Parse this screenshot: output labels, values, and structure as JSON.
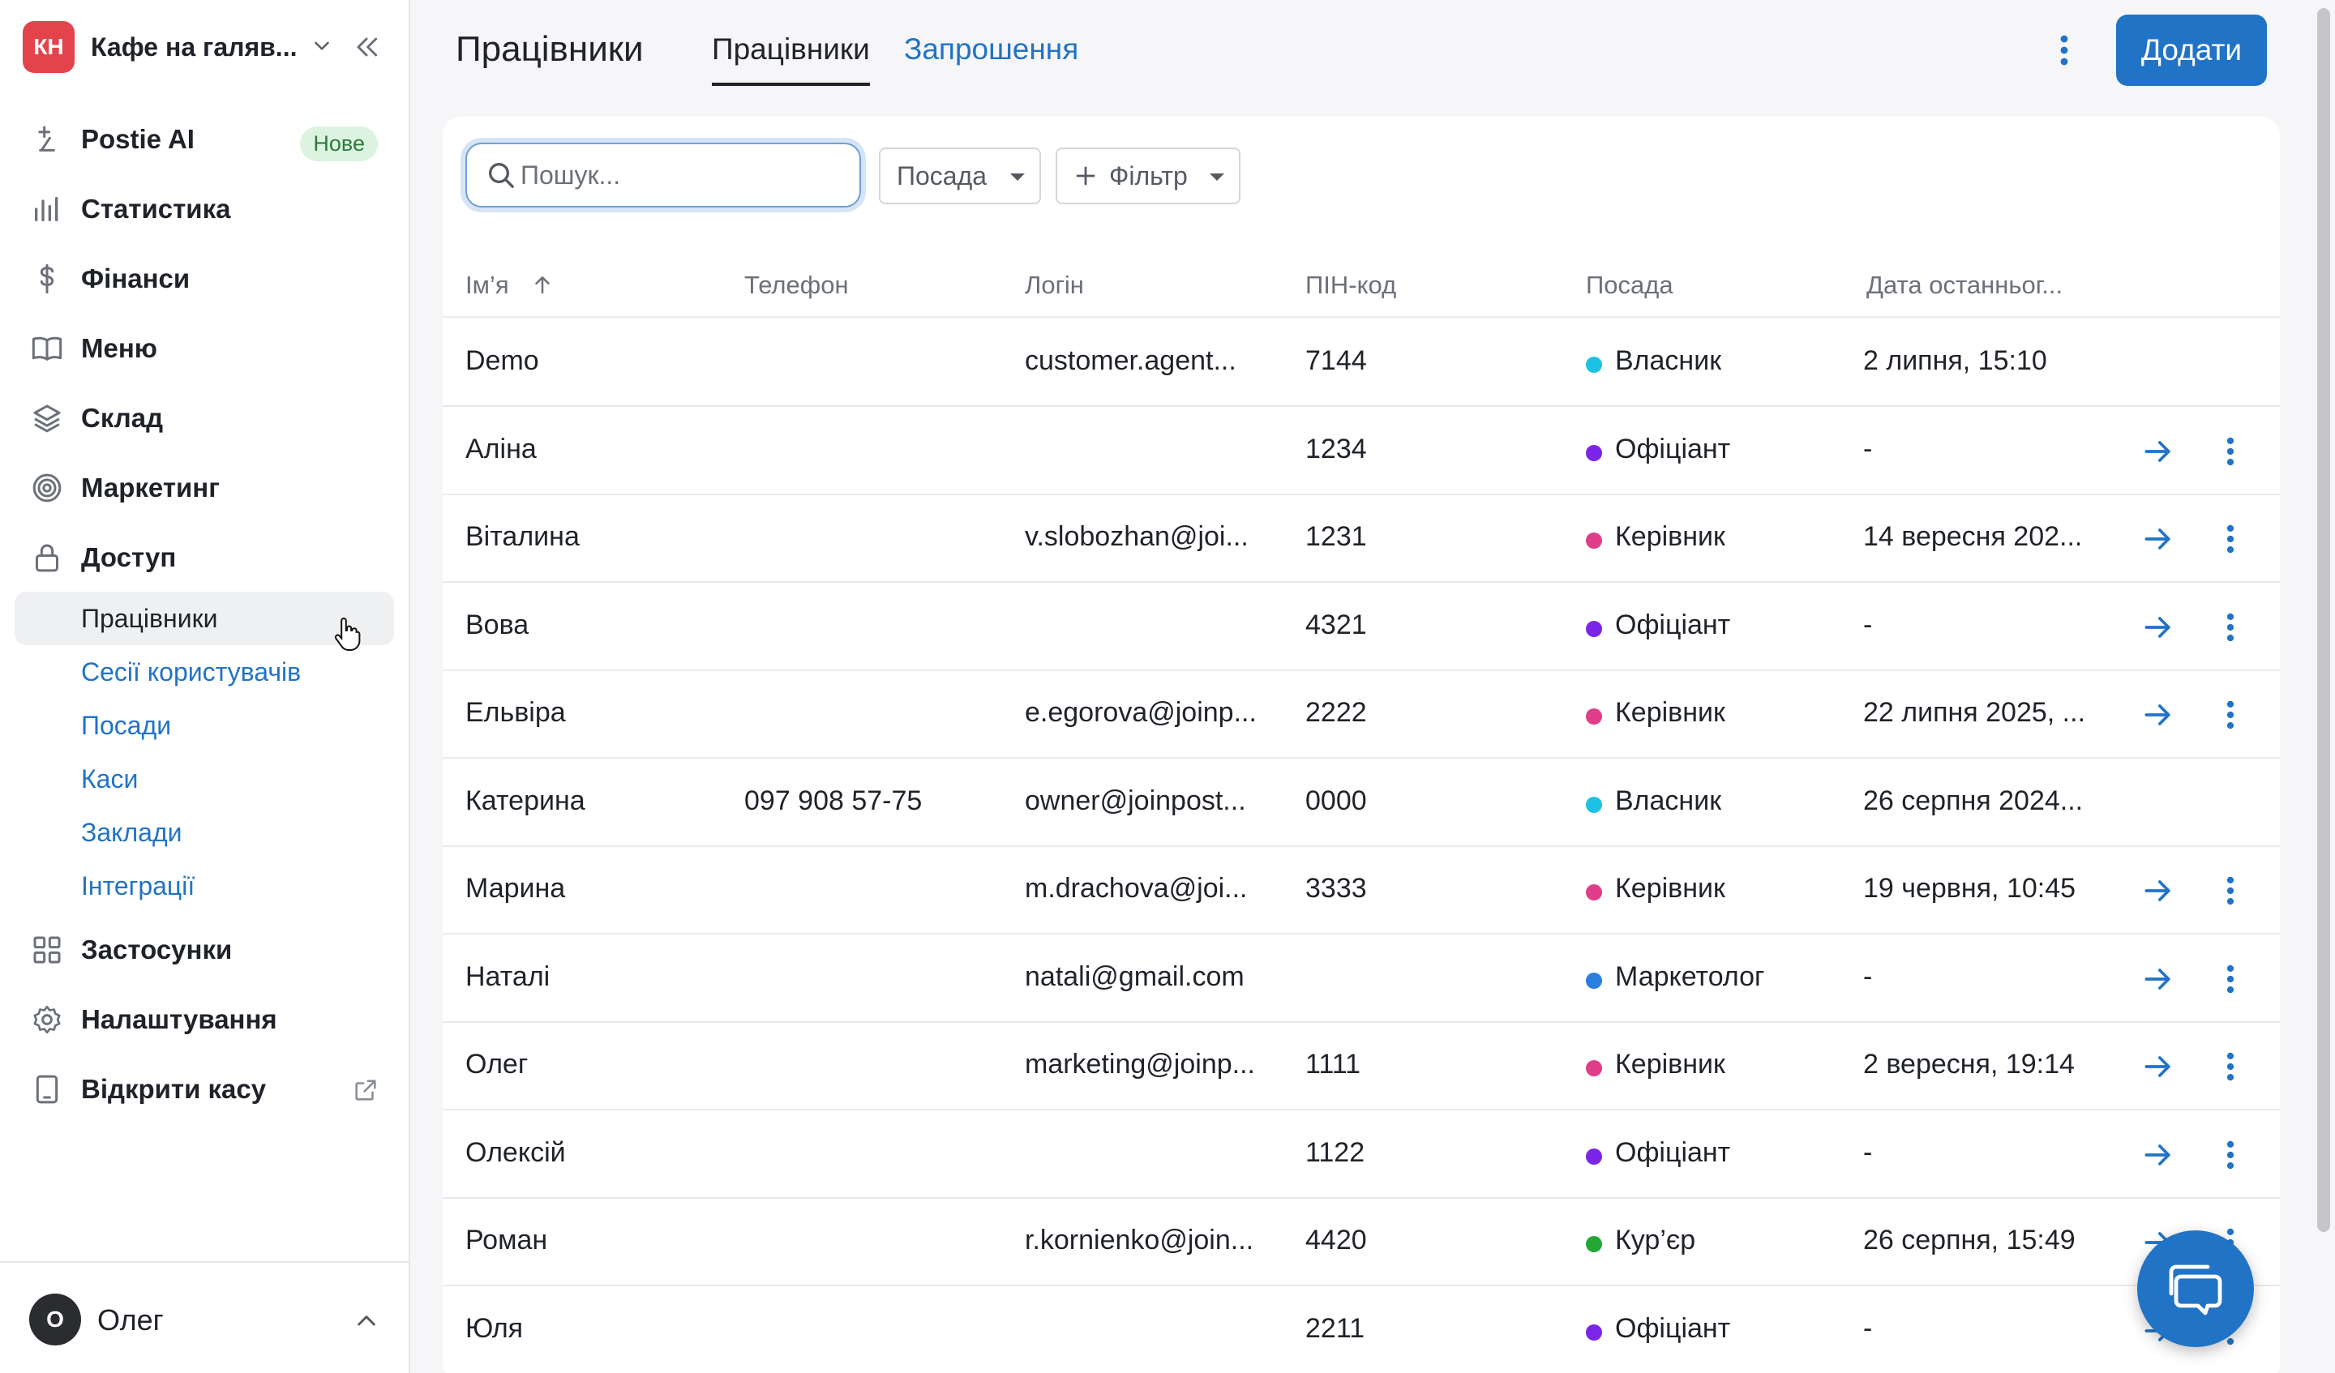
{
  "sidebar": {
    "venue_initials": "КН",
    "venue_name": "Кафе на галяв...",
    "items": [
      {
        "label": "Postie AI",
        "icon": "sparkle-icon",
        "badge": "Нове"
      },
      {
        "label": "Статистика",
        "icon": "bar-chart-icon"
      },
      {
        "label": "Фінанси",
        "icon": "dollar-icon"
      },
      {
        "label": "Меню",
        "icon": "book-icon"
      },
      {
        "label": "Склад",
        "icon": "layers-icon"
      },
      {
        "label": "Маркетинг",
        "icon": "target-icon"
      },
      {
        "label": "Доступ",
        "icon": "lock-icon"
      }
    ],
    "sub_items": [
      {
        "label": "Працівники",
        "active": true
      },
      {
        "label": "Сесії користувачів"
      },
      {
        "label": "Посади"
      },
      {
        "label": "Каси"
      },
      {
        "label": "Заклади"
      },
      {
        "label": "Інтеграції"
      }
    ],
    "bottom_items": [
      {
        "label": "Застосунки",
        "icon": "grid-icon"
      },
      {
        "label": "Налаштування",
        "icon": "gear-icon"
      },
      {
        "label": "Відкрити касу",
        "icon": "tablet-icon"
      }
    ],
    "user": {
      "initial": "О",
      "name": "Олег"
    }
  },
  "header": {
    "title": "Працівники",
    "tabs": [
      "Працівники",
      "Запрошення"
    ],
    "add_button": "Додати"
  },
  "toolbar": {
    "search_placeholder": "Пошук...",
    "position_filter": "Посада",
    "add_filter": "Фільтр"
  },
  "table": {
    "columns": [
      "Ім’я",
      "Телефон",
      "Логін",
      "ПІН-код",
      "Посада",
      "Дата останньог..."
    ],
    "sorted_column": "Ім’я",
    "sort_direction": "ascending",
    "rows": [
      {
        "name": "Demo",
        "phone": "",
        "login": "customer.agent...",
        "pin": "7144",
        "position": "Власник",
        "color": "#1ec1e6",
        "date": "2 липня, 15:10",
        "actions": false
      },
      {
        "name": "Аліна",
        "phone": "",
        "login": "",
        "pin": "1234",
        "position": "Офіціант",
        "color": "#7b25e8",
        "date": "-",
        "actions": true
      },
      {
        "name": "Віталина",
        "phone": "",
        "login": "v.slobozhan@joi...",
        "pin": "1231",
        "position": "Керівник",
        "color": "#e03d8a",
        "date": "14 вересня 202...",
        "actions": true
      },
      {
        "name": "Вова",
        "phone": "",
        "login": "",
        "pin": "4321",
        "position": "Офіціант",
        "color": "#7b25e8",
        "date": "-",
        "actions": true
      },
      {
        "name": "Ельвіра",
        "phone": "",
        "login": "e.egorova@joinp...",
        "pin": "2222",
        "position": "Керівник",
        "color": "#e03d8a",
        "date": "22 липня 2025, ...",
        "actions": true
      },
      {
        "name": "Катерина",
        "phone": "097 908 57-75",
        "login": "owner@joinpost...",
        "pin": "0000",
        "position": "Власник",
        "color": "#1ec1e6",
        "date": "26 серпня 2024...",
        "actions": false
      },
      {
        "name": "Марина",
        "phone": "",
        "login": "m.drachova@joi...",
        "pin": "3333",
        "position": "Керівник",
        "color": "#e03d8a",
        "date": "19 червня, 10:45",
        "actions": true
      },
      {
        "name": "Наталі",
        "phone": "",
        "login": "natali@gmail.com",
        "pin": "",
        "position": "Маркетолог",
        "color": "#2a7fe0",
        "date": "-",
        "actions": true
      },
      {
        "name": "Олег",
        "phone": "",
        "login": "marketing@joinp...",
        "pin": "1111",
        "position": "Керівник",
        "color": "#e03d8a",
        "date": "2 вересня, 19:14",
        "actions": true
      },
      {
        "name": "Олексій",
        "phone": "",
        "login": "",
        "pin": "1122",
        "position": "Офіціант",
        "color": "#7b25e8",
        "date": "-",
        "actions": true
      },
      {
        "name": "Роман",
        "phone": "",
        "login": "r.kornienko@join...",
        "pin": "4420",
        "position": "Кур’єр",
        "color": "#23a836",
        "date": "26 серпня, 15:49",
        "actions": true
      },
      {
        "name": "Юля",
        "phone": "",
        "login": "",
        "pin": "2211",
        "position": "Офіціант",
        "color": "#7b25e8",
        "date": "-",
        "actions": true
      }
    ]
  },
  "colors": {
    "accent": "#2173c6",
    "venue_avatar": "#e3434a",
    "new_badge_bg": "#dcf3df"
  }
}
